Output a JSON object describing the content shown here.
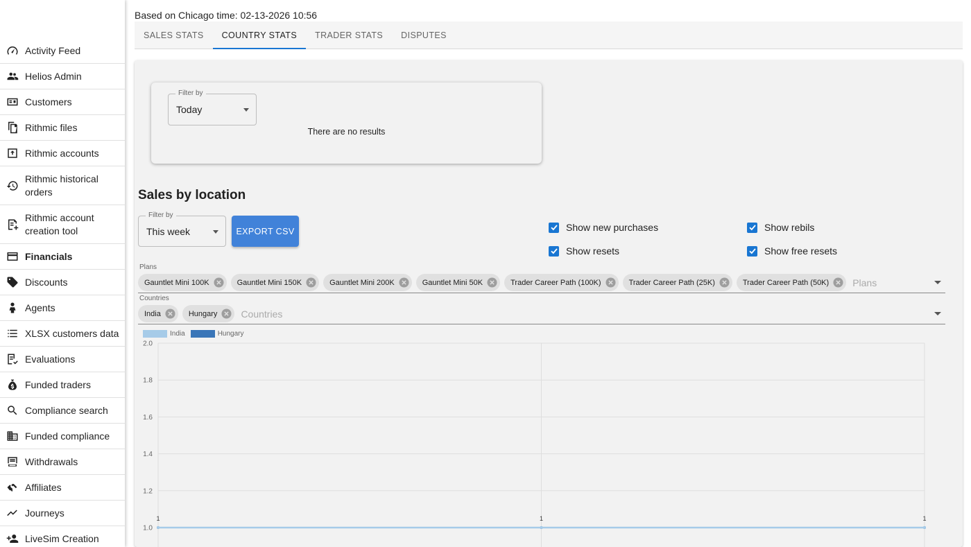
{
  "sidebar": {
    "items": [
      {
        "label": "Activity Feed",
        "icon": "speedometer-icon"
      },
      {
        "label": "Helios Admin",
        "icon": "people-icon"
      },
      {
        "label": "Customers",
        "icon": "id-card-icon"
      },
      {
        "label": "Rithmic files",
        "icon": "files-icon"
      },
      {
        "label": "Rithmic accounts",
        "icon": "upload-box-icon"
      },
      {
        "label": "Rithmic historical orders",
        "icon": "history-icon"
      },
      {
        "label": "Rithmic account creation tool",
        "icon": "note-add-icon"
      },
      {
        "label": "Financials",
        "icon": "credit-card-icon"
      },
      {
        "label": "Discounts",
        "icon": "tag-icon"
      },
      {
        "label": "Agents",
        "icon": "person-icon"
      },
      {
        "label": "XLSX customers data",
        "icon": "list-icon"
      },
      {
        "label": "Evaluations",
        "icon": "checklist-icon"
      },
      {
        "label": "Funded traders",
        "icon": "money-bag-icon"
      },
      {
        "label": "Compliance search",
        "icon": "search-icon"
      },
      {
        "label": "Funded compliance",
        "icon": "building-icon"
      },
      {
        "label": "Withdrawals",
        "icon": "receipt-icon"
      },
      {
        "label": "Affiliates",
        "icon": "handshake-icon"
      },
      {
        "label": "Journeys",
        "icon": "trend-line-icon"
      },
      {
        "label": "LiveSim Creation",
        "icon": "person-add-icon"
      }
    ]
  },
  "header": {
    "time_text": "Based on Chicago time: 02-13-2026 10:56"
  },
  "tabs": [
    {
      "label": "SALES STATS"
    },
    {
      "label": "COUNTRY STATS"
    },
    {
      "label": "TRADER STATS"
    },
    {
      "label": "DISPUTES"
    }
  ],
  "top_card": {
    "filter_label": "Filter by",
    "filter_value": "Today",
    "no_results": "There are no results"
  },
  "sales": {
    "title": "Sales by location",
    "filter_label": "Filter by",
    "filter_value": "This week",
    "export_label": "EXPORT CSV",
    "checkboxes": {
      "new_purchases": "Show new purchases",
      "rebils": "Show rebils",
      "resets": "Show resets",
      "free_resets": "Show free resets"
    },
    "plans_label": "Plans",
    "plans_placeholder": "Plans",
    "plans": [
      "Gauntlet Mini 100K",
      "Gauntlet Mini 150K",
      "Gauntlet Mini 200K",
      "Gauntlet Mini 50K",
      "Trader Career Path (100K)",
      "Trader Career Path (25K)",
      "Trader Career Path (50K)"
    ],
    "countries_label": "Countries",
    "countries_placeholder": "Countries",
    "countries": [
      "India",
      "Hungary"
    ]
  },
  "colors": {
    "accent": "#1976d2",
    "button": "#4182d9",
    "india": "#a6cbe8",
    "hungary": "#3a76b8"
  },
  "chart_data": {
    "type": "line",
    "series": [
      {
        "name": "India",
        "values": [
          1,
          1,
          1
        ],
        "data_labels": [
          "1",
          "1",
          "1"
        ]
      },
      {
        "name": "Hungary",
        "values": [
          1,
          1,
          1
        ],
        "data_labels": [
          "1",
          "1",
          "1"
        ]
      }
    ],
    "x_count": 3,
    "yticks": [
      "1.0",
      "1.2",
      "1.4",
      "1.6",
      "1.8",
      "2.0"
    ],
    "ylim": [
      1.0,
      2.0
    ],
    "xlabel": "",
    "ylabel": "",
    "grid": true,
    "legend": "top-left"
  }
}
